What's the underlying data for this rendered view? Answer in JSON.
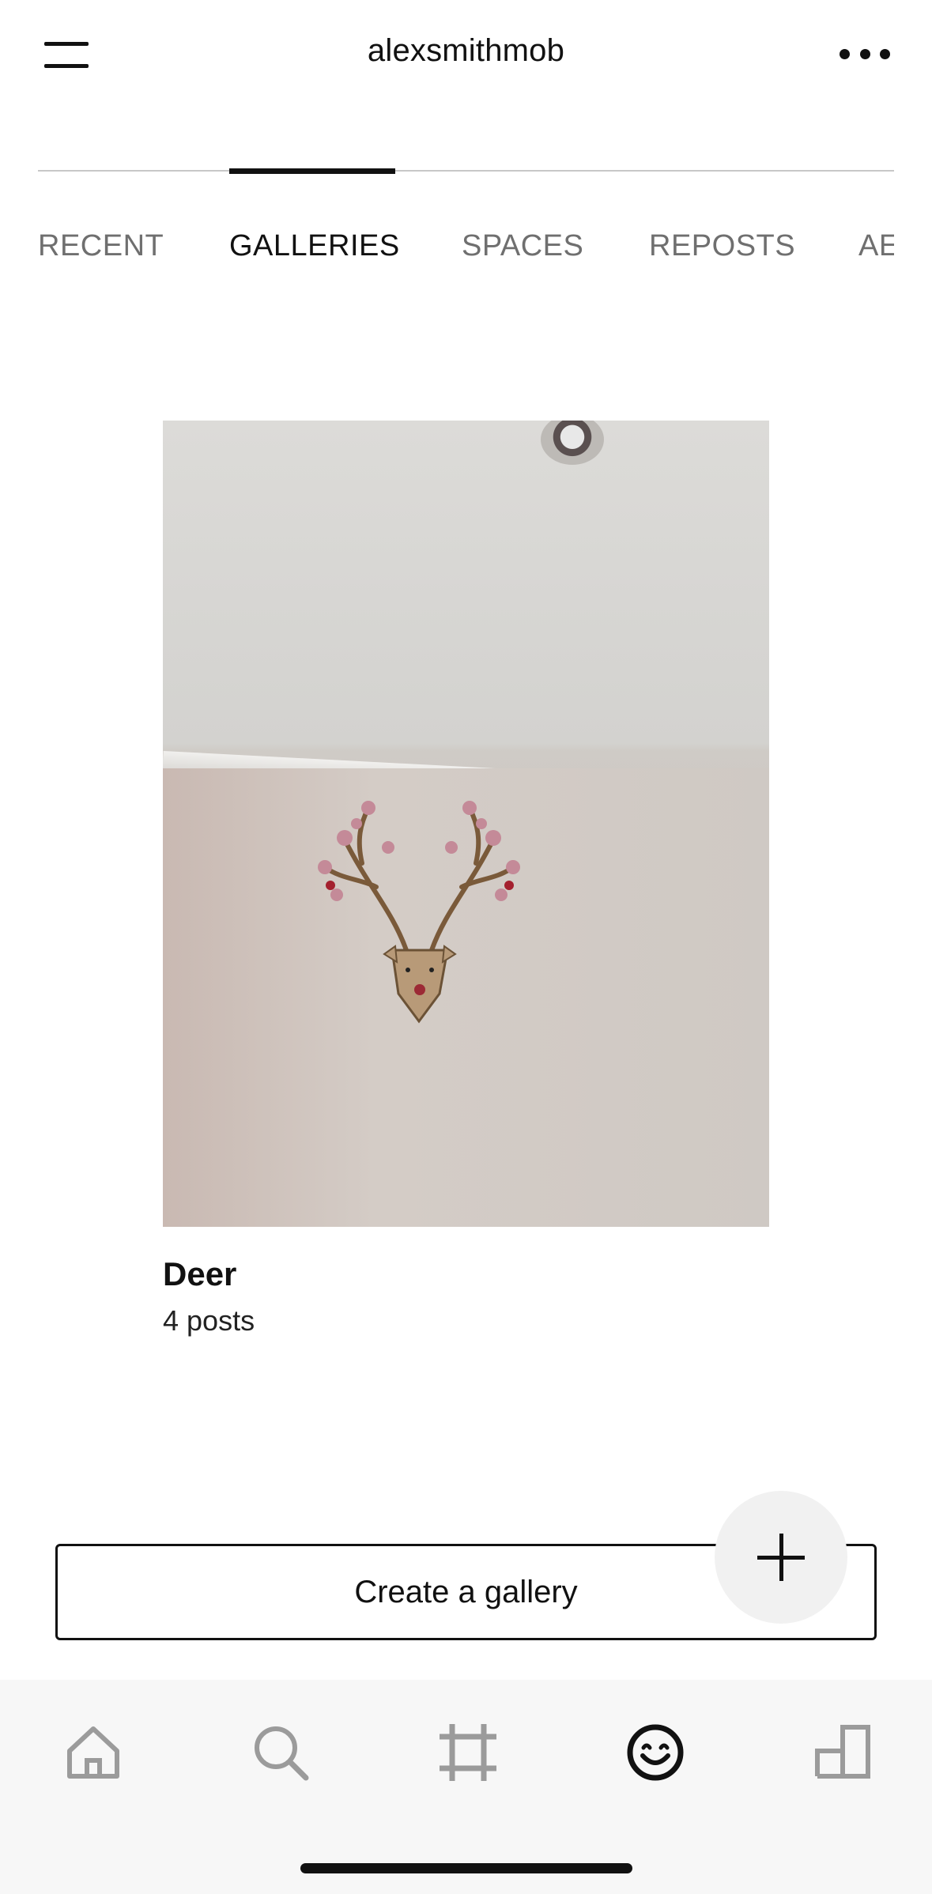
{
  "header": {
    "title": "alexsmithmob",
    "menu_icon": "hamburger-menu-icon",
    "more_icon": "more-horizontal-icon"
  },
  "tabs": [
    {
      "label": "RECENT"
    },
    {
      "label": "GALLERIES",
      "active": true
    },
    {
      "label": "SPACES"
    },
    {
      "label": "REPOSTS"
    },
    {
      "label": "AE"
    }
  ],
  "gallery": {
    "title": "Deer",
    "count": "4 posts"
  },
  "actions": {
    "create_label": "Create a gallery",
    "fab_icon": "plus-icon"
  },
  "bottom_nav": [
    {
      "icon": "home-icon"
    },
    {
      "icon": "search-icon"
    },
    {
      "icon": "frame-icon"
    },
    {
      "icon": "smiley-icon",
      "active": true
    },
    {
      "icon": "buildings-icon"
    }
  ],
  "colors": {
    "text": "#111111",
    "inactive_tab": "#6f6f6f",
    "nav_inactive": "#9b9b9b",
    "nav_background": "#f7f7f7"
  }
}
